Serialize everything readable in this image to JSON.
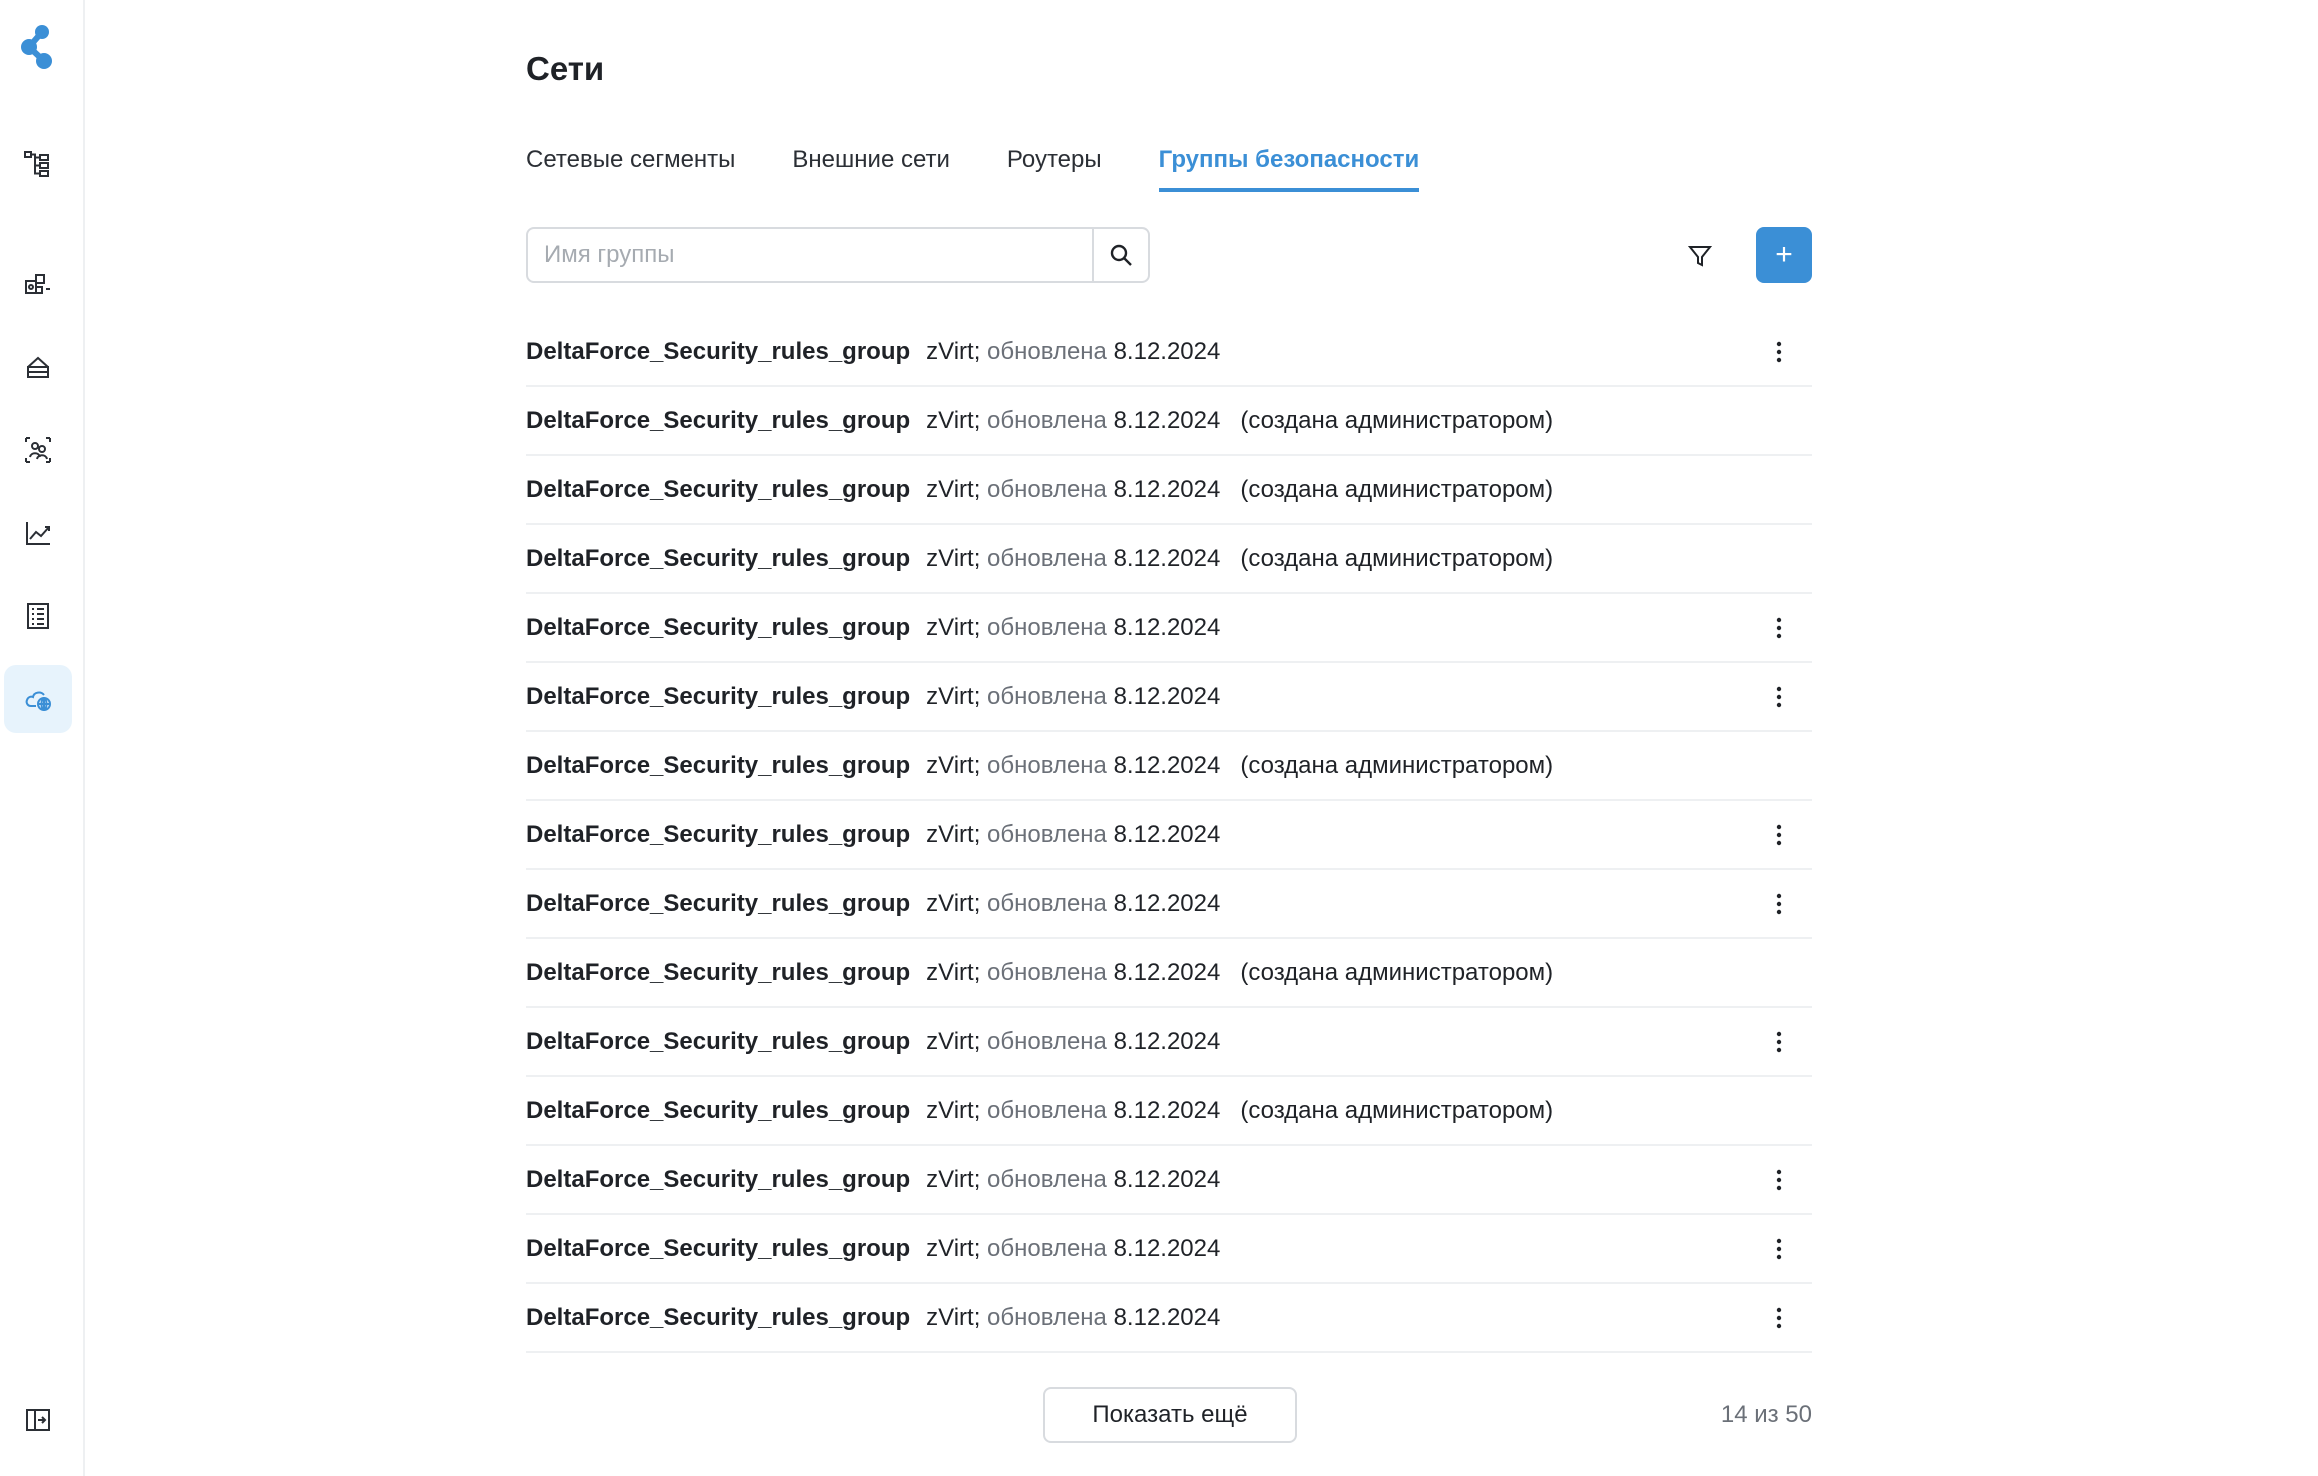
{
  "page": {
    "title": "Сети"
  },
  "tabs": [
    {
      "label": "Сетевые сегменты",
      "active": false
    },
    {
      "label": "Внешние сети",
      "active": false
    },
    {
      "label": "Роутеры",
      "active": false
    },
    {
      "label": "Группы безопасности",
      "active": true
    }
  ],
  "search": {
    "placeholder": "Имя группы",
    "value": ""
  },
  "toolbar": {
    "add_label": "+"
  },
  "colors": {
    "accent": "#3b8fd6",
    "active_nav_bg": "#e7f3fc",
    "border": "#d8dbdf"
  },
  "sidebar": {
    "items": [
      {
        "icon": "topology-icon",
        "active": false
      },
      {
        "icon": "components-icon",
        "active": false
      },
      {
        "icon": "storage-icon",
        "active": false
      },
      {
        "icon": "users-icon",
        "active": false
      },
      {
        "icon": "chart-icon",
        "active": false
      },
      {
        "icon": "list-icon",
        "active": false
      },
      {
        "icon": "cloud-network-icon",
        "active": true
      }
    ],
    "collapse_icon": "collapse-sidebar-icon"
  },
  "groups": [
    {
      "name": "DeltaForce_Security_rules_group",
      "platform": "zVirt;",
      "updated_label": "обновлена",
      "date": "8.12.2024",
      "creator": "",
      "has_menu": true
    },
    {
      "name": "DeltaForce_Security_rules_group",
      "platform": "zVirt;",
      "updated_label": "обновлена",
      "date": "8.12.2024",
      "creator": "(создана администратором)",
      "has_menu": false
    },
    {
      "name": "DeltaForce_Security_rules_group",
      "platform": "zVirt;",
      "updated_label": "обновлена",
      "date": "8.12.2024",
      "creator": "(создана администратором)",
      "has_menu": false
    },
    {
      "name": "DeltaForce_Security_rules_group",
      "platform": "zVirt;",
      "updated_label": "обновлена",
      "date": "8.12.2024",
      "creator": "(создана администратором)",
      "has_menu": false
    },
    {
      "name": "DeltaForce_Security_rules_group",
      "platform": "zVirt;",
      "updated_label": "обновлена",
      "date": "8.12.2024",
      "creator": "",
      "has_menu": true
    },
    {
      "name": "DeltaForce_Security_rules_group",
      "platform": "zVirt;",
      "updated_label": "обновлена",
      "date": "8.12.2024",
      "creator": "",
      "has_menu": true
    },
    {
      "name": "DeltaForce_Security_rules_group",
      "platform": "zVirt;",
      "updated_label": "обновлена",
      "date": "8.12.2024",
      "creator": "(создана администратором)",
      "has_menu": false
    },
    {
      "name": "DeltaForce_Security_rules_group",
      "platform": "zVirt;",
      "updated_label": "обновлена",
      "date": "8.12.2024",
      "creator": "",
      "has_menu": true
    },
    {
      "name": "DeltaForce_Security_rules_group",
      "platform": "zVirt;",
      "updated_label": "обновлена",
      "date": "8.12.2024",
      "creator": "",
      "has_menu": true
    },
    {
      "name": "DeltaForce_Security_rules_group",
      "platform": "zVirt;",
      "updated_label": "обновлена",
      "date": "8.12.2024",
      "creator": "(создана администратором)",
      "has_menu": false
    },
    {
      "name": "DeltaForce_Security_rules_group",
      "platform": "zVirt;",
      "updated_label": "обновлена",
      "date": "8.12.2024",
      "creator": "",
      "has_menu": true
    },
    {
      "name": "DeltaForce_Security_rules_group",
      "platform": "zVirt;",
      "updated_label": "обновлена",
      "date": "8.12.2024",
      "creator": "(создана администратором)",
      "has_menu": false
    },
    {
      "name": "DeltaForce_Security_rules_group",
      "platform": "zVirt;",
      "updated_label": "обновлена",
      "date": "8.12.2024",
      "creator": "",
      "has_menu": true
    },
    {
      "name": "DeltaForce_Security_rules_group",
      "platform": "zVirt;",
      "updated_label": "обновлена",
      "date": "8.12.2024",
      "creator": "",
      "has_menu": true
    },
    {
      "name": "DeltaForce_Security_rules_group",
      "platform": "zVirt;",
      "updated_label": "обновлена",
      "date": "8.12.2024",
      "creator": "",
      "has_menu": true
    }
  ],
  "footer": {
    "show_more_label": "Показать ещё",
    "counter": "14 из 50"
  }
}
